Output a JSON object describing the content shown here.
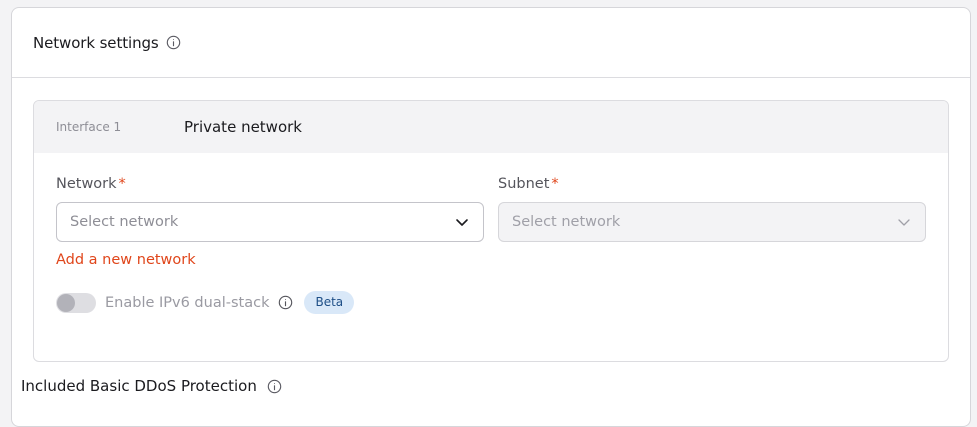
{
  "network_settings": {
    "title": "Network settings",
    "interface": {
      "label": "Interface 1",
      "value": "Private network"
    },
    "network_field": {
      "label": "Network",
      "required_mark": "*",
      "placeholder": "Select network"
    },
    "subnet_field": {
      "label": "Subnet",
      "required_mark": "*",
      "placeholder": "Select network",
      "disabled": true
    },
    "add_network_link": "Add a new network",
    "ipv6_toggle": {
      "label": "Enable IPv6 dual-stack",
      "enabled": false,
      "disabled": true,
      "badge": "Beta"
    },
    "ddos_label": "Included Basic DDoS Protection"
  },
  "colors": {
    "accent": "#e0461b",
    "badge_bg": "#d9e8f8",
    "badge_text": "#1d4e86",
    "border": "#dcdce0"
  },
  "icons": {
    "info": "info-icon",
    "chevron": "chevron-down-icon"
  }
}
